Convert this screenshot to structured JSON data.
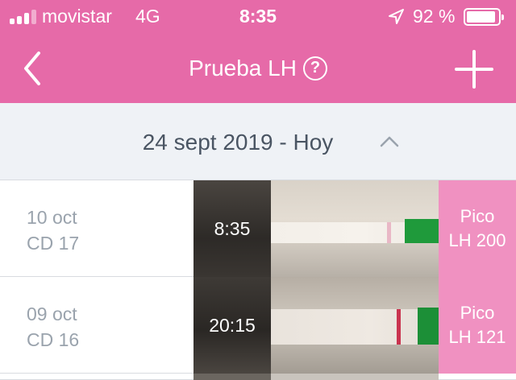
{
  "status_bar": {
    "carrier": "movistar",
    "network": "4G",
    "time": "8:35",
    "battery_percent": "92 %",
    "battery_level": 0.92,
    "signal_bars": 3,
    "icons": [
      "signal-bars-icon",
      "location-arrow-icon",
      "battery-icon"
    ]
  },
  "nav": {
    "title": "Prueba LH",
    "help_label": "?",
    "back_icon": "chevron-left-icon",
    "add_icon": "plus-icon"
  },
  "cycle": {
    "label": "24 sept 2019 - Hoy",
    "toggle_icon": "chevron-up-icon"
  },
  "entries": [
    {
      "date": "10 oct",
      "cycle_day": "CD 17",
      "time": "8:35",
      "result": "Pico",
      "lh": "LH 200"
    },
    {
      "date": "09 oct",
      "cycle_day": "CD 16",
      "time": "20:15",
      "result": "Pico",
      "lh": "LH 121"
    }
  ],
  "colors": {
    "brand_pink": "#e66aa8",
    "result_pink": "#f091c1",
    "section_bg": "#eff2f6",
    "muted_text": "#9aa3ad"
  }
}
